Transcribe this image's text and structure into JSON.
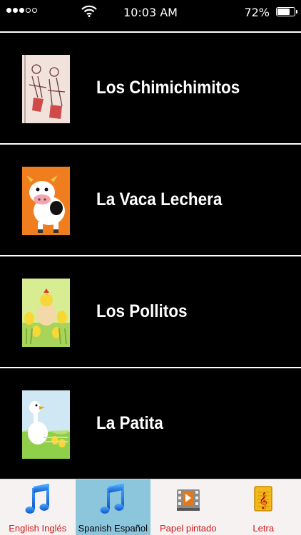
{
  "status_bar": {
    "time": "10:03 AM",
    "battery_percent": "72%",
    "battery_level": 0.72,
    "signal_bars_filled": 3,
    "signal_bars_total": 5
  },
  "songs": [
    {
      "title": "Los Chimichimitos",
      "thumbnail": "cartoon-drawing-icon"
    },
    {
      "title": "La Vaca Lechera",
      "thumbnail": "cow-icon"
    },
    {
      "title": "Los Pollitos",
      "thumbnail": "chicks-icon"
    },
    {
      "title": "La Patita",
      "thumbnail": "duck-icon"
    }
  ],
  "tabs": [
    {
      "label": "English Inglés",
      "icon": "music-note-icon",
      "selected": false,
      "color": "#d01818"
    },
    {
      "label": "Spanish Español",
      "icon": "music-note-icon",
      "selected": true,
      "color": "#000000"
    },
    {
      "label": "Papel pintado",
      "icon": "film-icon",
      "selected": false,
      "color": "#d01818"
    },
    {
      "label": "Letra",
      "icon": "music-sheet-icon",
      "selected": false,
      "color": "#d01818"
    }
  ],
  "colors": {
    "background": "#000000",
    "tab_bar": "#f7f2f2",
    "tab_selected": "#8cc6dd",
    "tab_label": "#d01818"
  }
}
